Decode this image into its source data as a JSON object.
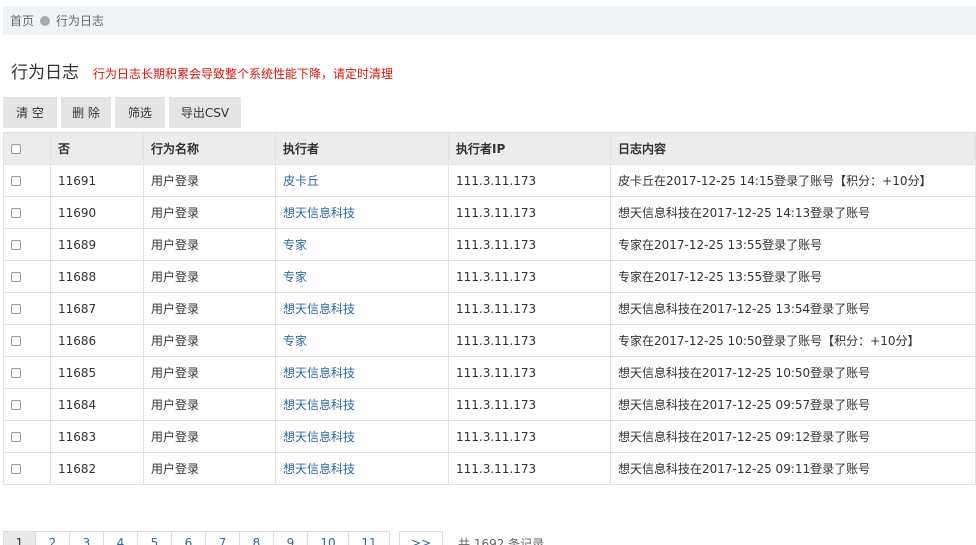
{
  "breadcrumb": {
    "home": "首页",
    "current": "行为日志"
  },
  "page": {
    "title": "行为日志",
    "warning": "行为日志长期积累会导致整个系统性能下降，请定时清理"
  },
  "toolbar": {
    "clear": "清 空",
    "delete": "删 除",
    "filter": "筛选",
    "export": "导出CSV"
  },
  "table": {
    "headers": [
      "否",
      "行为名称",
      "执行者",
      "执行者IP",
      "日志内容"
    ],
    "rows": [
      {
        "id": "11691",
        "action": "用户登录",
        "user": "皮卡丘",
        "ip": "111.3.11.173",
        "content": "皮卡丘在2017-12-25 14:15登录了账号【积分：+10分】"
      },
      {
        "id": "11690",
        "action": "用户登录",
        "user": "想天信息科技",
        "ip": "111.3.11.173",
        "content": "想天信息科技在2017-12-25 14:13登录了账号"
      },
      {
        "id": "11689",
        "action": "用户登录",
        "user": "专家",
        "ip": "111.3.11.173",
        "content": "专家在2017-12-25 13:55登录了账号"
      },
      {
        "id": "11688",
        "action": "用户登录",
        "user": "专家",
        "ip": "111.3.11.173",
        "content": "专家在2017-12-25 13:55登录了账号"
      },
      {
        "id": "11687",
        "action": "用户登录",
        "user": "想天信息科技",
        "ip": "111.3.11.173",
        "content": "想天信息科技在2017-12-25 13:54登录了账号"
      },
      {
        "id": "11686",
        "action": "用户登录",
        "user": "专家",
        "ip": "111.3.11.173",
        "content": "专家在2017-12-25 10:50登录了账号【积分：+10分】"
      },
      {
        "id": "11685",
        "action": "用户登录",
        "user": "想天信息科技",
        "ip": "111.3.11.173",
        "content": "想天信息科技在2017-12-25 10:50登录了账号"
      },
      {
        "id": "11684",
        "action": "用户登录",
        "user": "想天信息科技",
        "ip": "111.3.11.173",
        "content": "想天信息科技在2017-12-25 09:57登录了账号"
      },
      {
        "id": "11683",
        "action": "用户登录",
        "user": "想天信息科技",
        "ip": "111.3.11.173",
        "content": "想天信息科技在2017-12-25 09:12登录了账号"
      },
      {
        "id": "11682",
        "action": "用户登录",
        "user": "想天信息科技",
        "ip": "111.3.11.173",
        "content": "想天信息科技在2017-12-25 09:11登录了账号"
      }
    ]
  },
  "pagination": {
    "pages": [
      "1",
      "2",
      "3",
      "4",
      "5",
      "6",
      "7",
      "8",
      "9",
      "10",
      "11"
    ],
    "next": ">>",
    "total": "共 1692 条记录"
  }
}
